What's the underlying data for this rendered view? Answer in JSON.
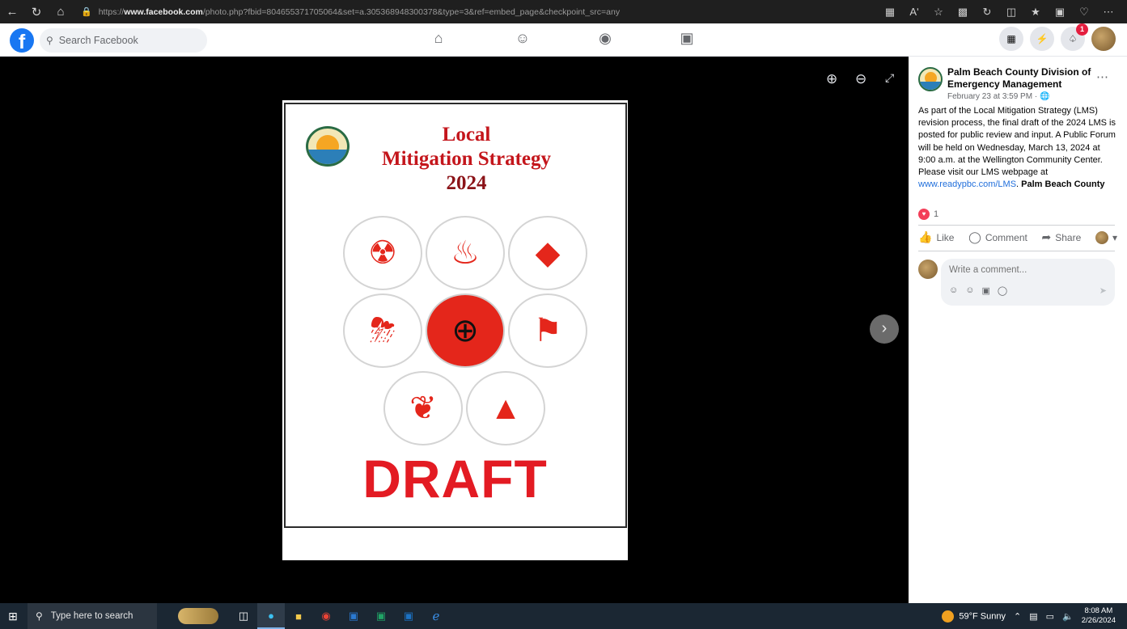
{
  "browser": {
    "url_prefix": "https://",
    "url_host": "www.facebook.com",
    "url_path": "/photo.php?fbid=804655371705064&set=a.305368948300378&type=3&ref=embed_page&checkpoint_src=any",
    "read_aloud_label": "Aʹ"
  },
  "facebook": {
    "search_placeholder": "Search Facebook",
    "notification_count": "1"
  },
  "document": {
    "title_line1": "Local",
    "title_line2": "Mitigation Strategy",
    "title_line3": "2024",
    "stamp": "DRAFT"
  },
  "post": {
    "page_name": "Palm Beach County Division of Emergency Management",
    "timestamp": "February 23 at 3:59 PM ·",
    "text": "As part of the Local Mitigation Strategy (LMS) revision process, the final draft of the 2024 LMS is posted for public review and input. A Public Forum will be held on Wednesday, March 13, 2024 at 9:00 a.m. at the Wellington Community Center. Please visit our LMS webpage at ",
    "link_text": "www.readypbc.com/LMS",
    "after_link": ".",
    "bold_tail": "Palm Beach County",
    "reaction_count": "1",
    "like_label": "Like",
    "comment_label": "Comment",
    "share_label": "Share",
    "comment_placeholder": "Write a comment..."
  },
  "taskbar": {
    "search_placeholder": "Type here to search",
    "weather": "59°F  Sunny",
    "time": "8:08 AM",
    "date": "2/26/2024"
  }
}
